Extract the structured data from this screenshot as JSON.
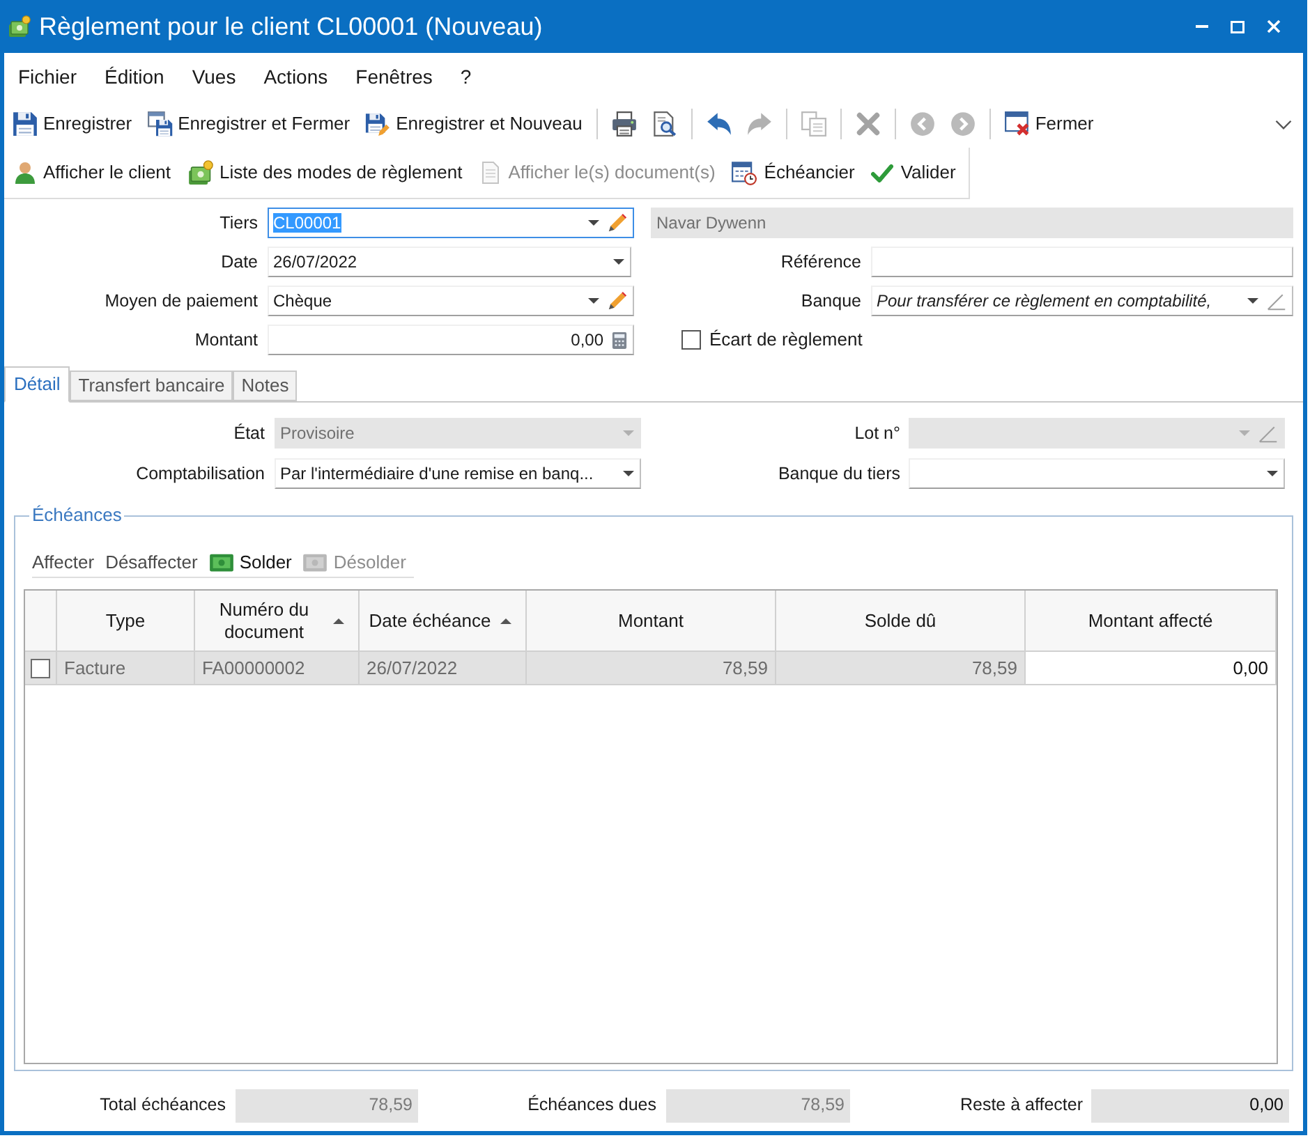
{
  "window": {
    "title": "Règlement pour le client CL00001 (Nouveau)"
  },
  "menu": [
    {
      "label": "Fichier"
    },
    {
      "label": "Édition"
    },
    {
      "label": "Vues"
    },
    {
      "label": "Actions"
    },
    {
      "label": "Fenêtres"
    },
    {
      "label": "?"
    }
  ],
  "toolbar": [
    {
      "kind": "button",
      "label": "Enregistrer",
      "disabled": false
    },
    {
      "kind": "button",
      "label": "Enregistrer et Fermer",
      "disabled": false
    },
    {
      "kind": "button",
      "label": "Enregistrer et Nouveau",
      "disabled": false
    },
    {
      "kind": "separator"
    },
    {
      "kind": "icon",
      "disabled": false
    },
    {
      "kind": "icon",
      "disabled": false
    },
    {
      "kind": "separator"
    },
    {
      "kind": "icon",
      "disabled": false
    },
    {
      "kind": "icon",
      "disabled": true
    },
    {
      "kind": "separator"
    },
    {
      "kind": "icon",
      "disabled": true
    },
    {
      "kind": "separator"
    },
    {
      "kind": "icon",
      "disabled": true
    },
    {
      "kind": "separator"
    },
    {
      "kind": "icon",
      "disabled": true
    },
    {
      "kind": "icon",
      "disabled": true
    },
    {
      "kind": "separator"
    },
    {
      "kind": "button",
      "label": "Fermer",
      "disabled": false
    }
  ],
  "actions_toolbar": [
    {
      "label": "Afficher le client",
      "disabled": false
    },
    {
      "label": "Liste des modes de règlement",
      "disabled": false
    },
    {
      "label": "Afficher le(s) document(s)",
      "disabled": true
    },
    {
      "label": "Échéancier",
      "disabled": false
    },
    {
      "label": "Valider",
      "disabled": false
    }
  ],
  "header": {
    "tiers": {
      "kind": "combo_edit",
      "label": "Tiers",
      "value": "CL00001",
      "focused": true,
      "disabled": false
    },
    "tiers_name": {
      "kind": "text",
      "value": "Navar Dywenn",
      "disabled": true
    },
    "date": {
      "kind": "combo",
      "label": "Date",
      "value": "26/07/2022",
      "disabled": false
    },
    "reference": {
      "kind": "text",
      "label": "Référence",
      "disabled": false
    },
    "payment_method": {
      "kind": "combo_edit",
      "label": "Moyen de paiement",
      "value": "Chèque",
      "disabled": false
    },
    "bank": {
      "kind": "combo_edit",
      "label": "Banque",
      "placeholder": "Pour transférer ce règlement en comptabilité,",
      "disabled": false
    },
    "amount": {
      "kind": "amount",
      "label": "Montant",
      "value": "0,00",
      "disabled": false
    },
    "settlement_gap": {
      "label": "Écart de règlement",
      "checked": false
    }
  },
  "tabs": [
    {
      "label": "Détail",
      "selected": true
    },
    {
      "label": "Transfert bancaire",
      "selected": false
    },
    {
      "label": "Notes",
      "selected": false
    }
  ],
  "detail": {
    "state": {
      "kind": "combo",
      "label": "État",
      "value": "Provisoire",
      "disabled": true
    },
    "lot": {
      "kind": "combo_edit",
      "label": "Lot n°",
      "disabled": true
    },
    "accounting": {
      "kind": "combo",
      "label": "Comptabilisation",
      "value": "Par l'intermédiaire d'une remise en banq...",
      "disabled": false
    },
    "third_party_bank": {
      "kind": "combo",
      "label": "Banque du tiers",
      "disabled": false
    }
  },
  "schedule": {
    "title": "Échéances",
    "actions": [
      {
        "kind": "text",
        "label": "Affecter",
        "disabled": false
      },
      {
        "kind": "text",
        "label": "Désaffecter",
        "disabled": false
      },
      {
        "kind": "icon_text",
        "label": "Solder",
        "disabled": false
      },
      {
        "kind": "icon_text",
        "label": "Désolder",
        "disabled": true
      }
    ],
    "columns": [
      {
        "label": "Type",
        "kind": "text",
        "sorted": false,
        "editable": false
      },
      {
        "label": "Numéro du document",
        "kind": "text",
        "sorted": true,
        "editable": false
      },
      {
        "label": "Date échéance",
        "kind": "text",
        "sorted": true,
        "editable": false
      },
      {
        "label": "Montant",
        "kind": "amount",
        "sorted": false,
        "editable": false
      },
      {
        "label": "Solde dû",
        "kind": "amount",
        "sorted": false,
        "editable": false
      },
      {
        "label": "Montant affecté",
        "kind": "amount",
        "sorted": false,
        "editable": true
      }
    ],
    "rows": [
      {
        "checked": false,
        "cells": [
          "Facture",
          "FA00000002",
          "26/07/2022",
          "78,59",
          "78,59",
          "0,00"
        ]
      }
    ]
  },
  "totals": [
    {
      "label": "Total échéances",
      "value": "78,59",
      "disabled": true
    },
    {
      "label": "Échéances dues",
      "value": "78,59",
      "disabled": true
    },
    {
      "label": "Reste à affecter",
      "value": "0,00",
      "disabled": false
    }
  ]
}
